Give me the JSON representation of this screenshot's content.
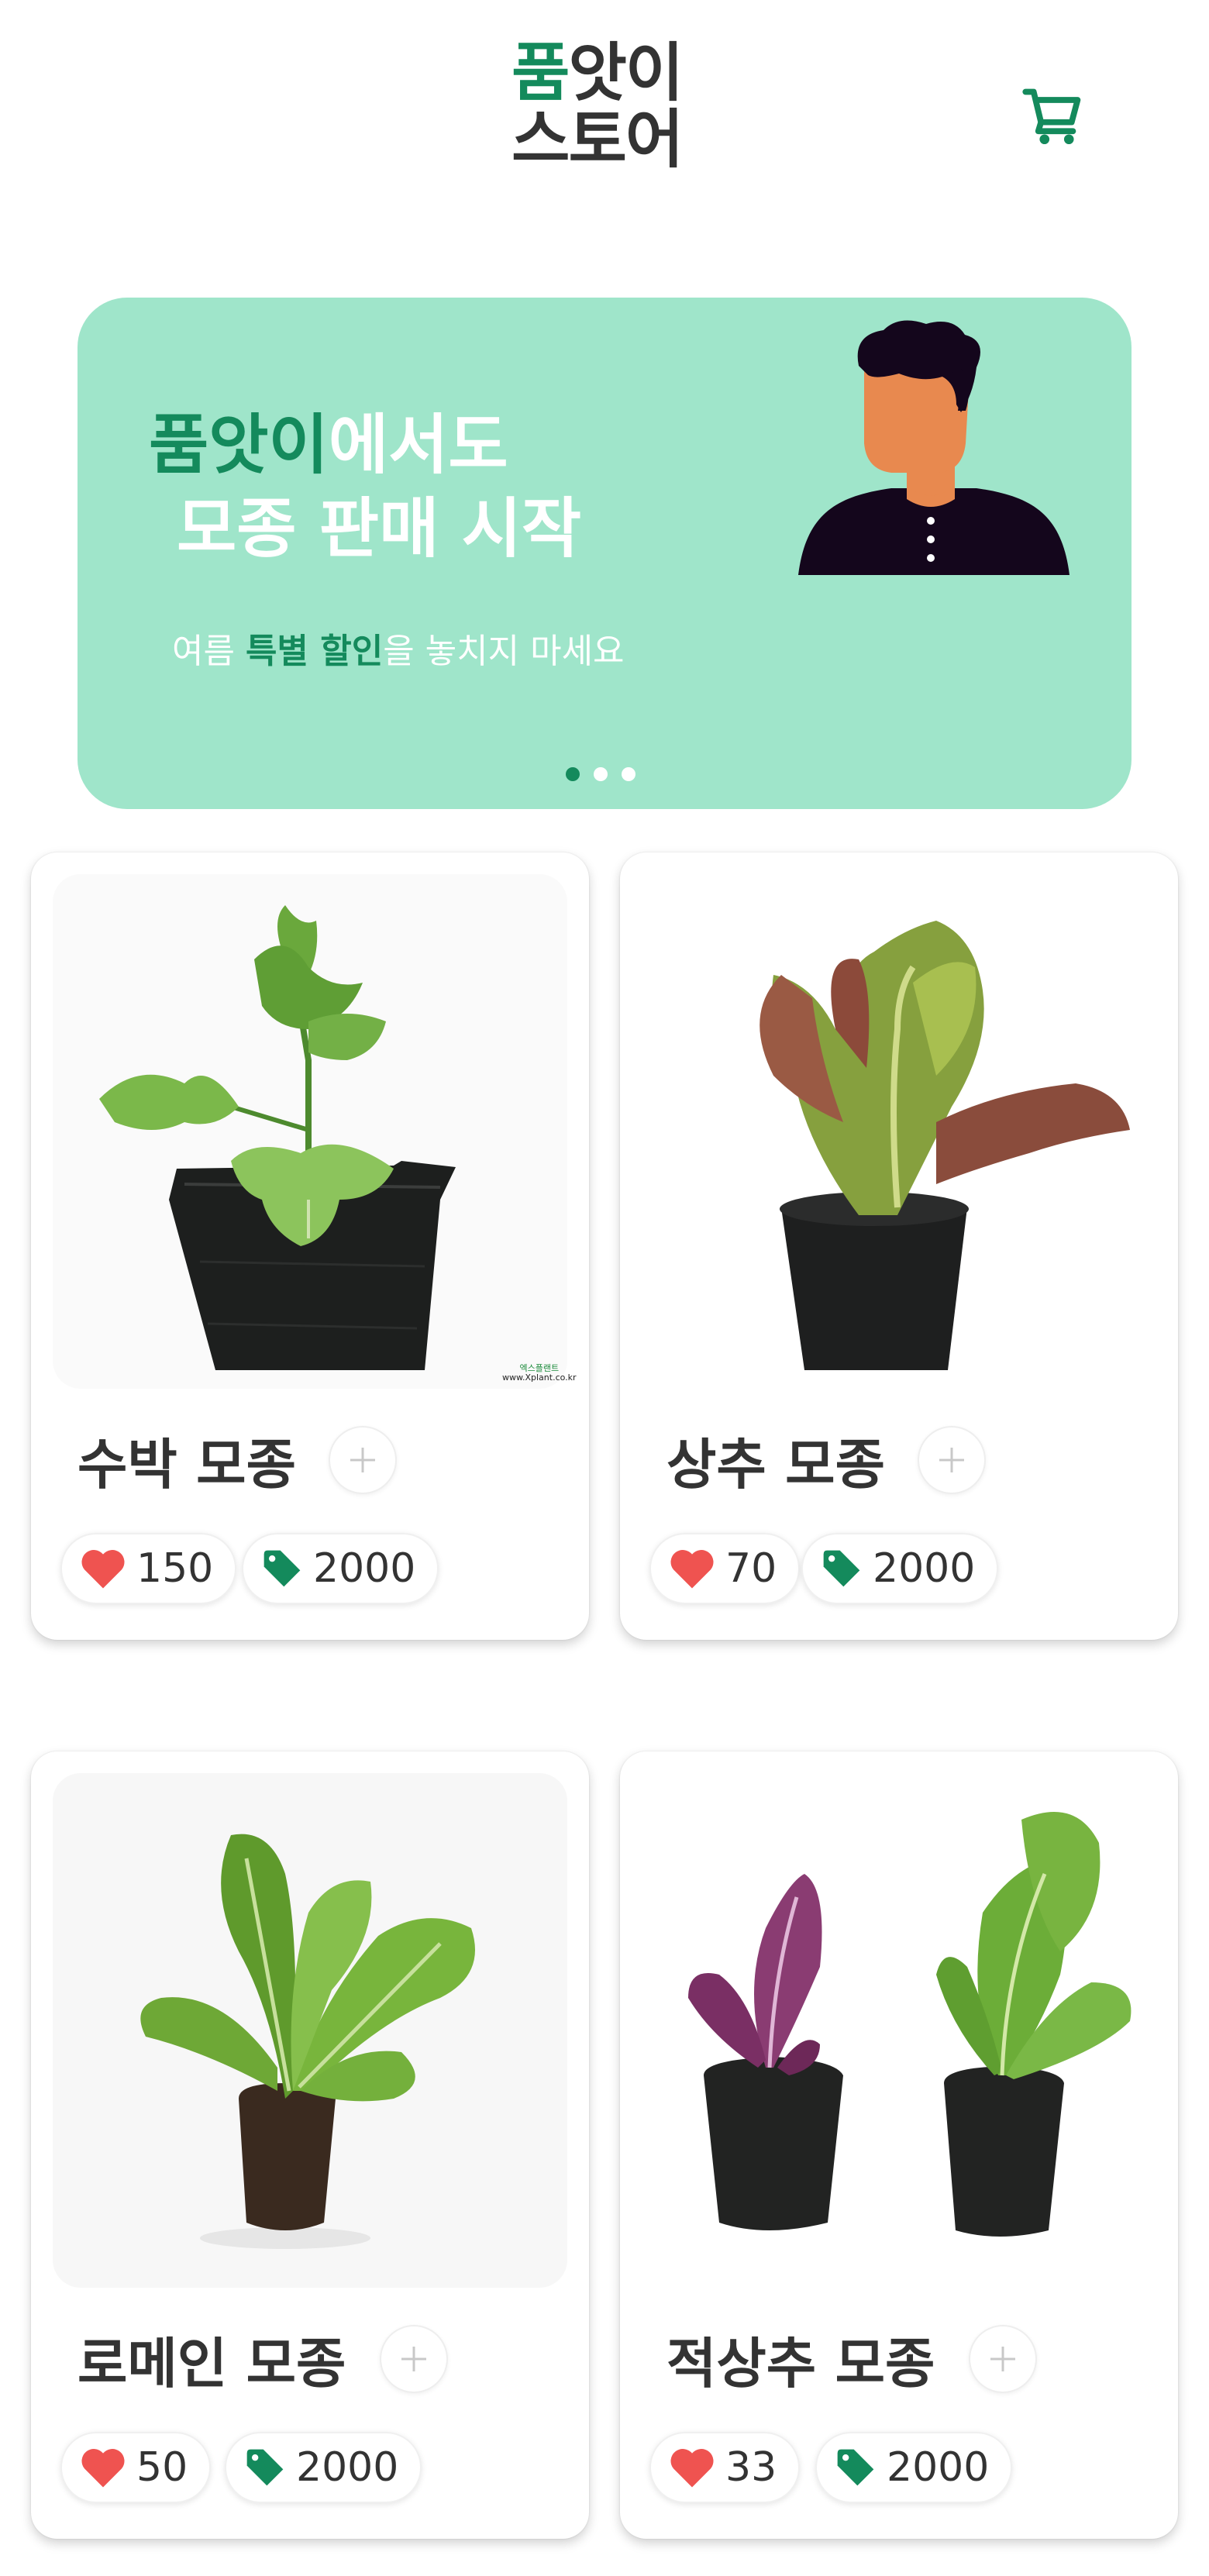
{
  "header": {
    "logo_line1_accent": "품",
    "logo_line1_rest": "앗이",
    "logo_line2": "스토어"
  },
  "banner": {
    "title_accent": "품앗이",
    "title_rest": "에서도",
    "title_line2": "모종 판매 시작",
    "sub_pre": "여름 ",
    "sub_accent": "특별 할인",
    "sub_post": "을 놓치지 마세요",
    "slide_index": 1,
    "slide_count": 3
  },
  "products": [
    {
      "name": "수박 모종",
      "likes": "150",
      "price": "2000",
      "watermark_top": "엑스플랜트",
      "watermark_url": "www.Xplant.co.kr"
    },
    {
      "name": "상추 모종",
      "likes": "70",
      "price": "2000"
    },
    {
      "name": "로메인 모종",
      "likes": "50",
      "price": "2000"
    },
    {
      "name": "적상추 모종",
      "likes": "33",
      "price": "2000"
    }
  ],
  "colors": {
    "accent": "#148a5c",
    "banner_bg": "#9fe5ca",
    "heart": "#ef5350",
    "tag": "#148a5c"
  },
  "icons": {
    "cart": "shopping-cart-icon",
    "add": "plus-icon",
    "likes": "heart-icon",
    "price": "price-tag-icon"
  }
}
